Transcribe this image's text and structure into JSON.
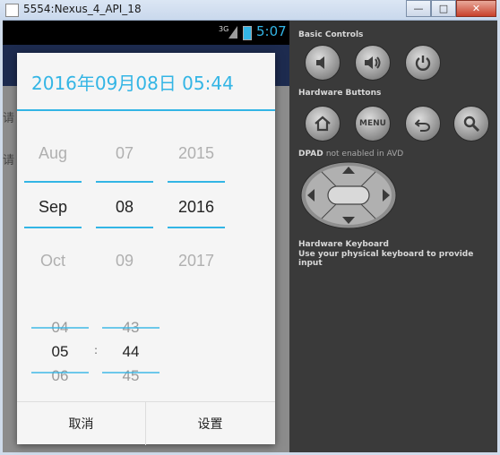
{
  "window": {
    "title": "5554:Nexus_4_API_18",
    "minimize": "—",
    "maximize": "□",
    "close": "✕"
  },
  "statusbar": {
    "network": "3G",
    "time": "5:07"
  },
  "app": {
    "hint1": "请",
    "hint2": "请"
  },
  "dialog": {
    "title": "2016年09月08日 05:44",
    "date_columns": [
      {
        "prev": "Aug",
        "current": "Sep",
        "next": "Oct"
      },
      {
        "prev": "07",
        "current": "08",
        "next": "09"
      },
      {
        "prev": "2015",
        "current": "2016",
        "next": "2017"
      }
    ],
    "time_columns": [
      {
        "prev": "04",
        "current": "05",
        "next": "06"
      },
      {
        "prev": "43",
        "current": "44",
        "next": "45"
      }
    ],
    "colon": ":",
    "cancel_label": "取消",
    "set_label": "设置"
  },
  "panel": {
    "basic_controls": "Basic Controls",
    "hardware_buttons": "Hardware Buttons",
    "menu_label": "MENU",
    "dpad_title": "DPAD",
    "dpad_note": "not enabled in AVD",
    "keyboard_title": "Hardware Keyboard",
    "keyboard_note": "Use your physical keyboard to provide input"
  },
  "colors": {
    "accent": "#33b5e5",
    "actionbar": "#1d2b4f",
    "panel": "#3a3a3a"
  }
}
